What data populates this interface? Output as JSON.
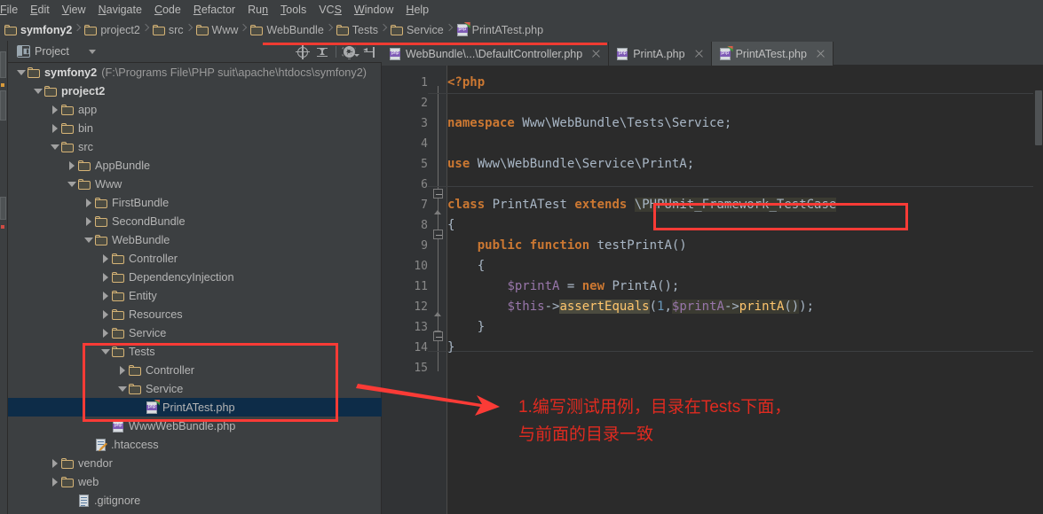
{
  "menubar": {
    "items": [
      {
        "label": "File",
        "mnemonic": "F"
      },
      {
        "label": "Edit",
        "mnemonic": "E"
      },
      {
        "label": "View",
        "mnemonic": "V"
      },
      {
        "label": "Navigate",
        "mnemonic": "N"
      },
      {
        "label": "Code",
        "mnemonic": "C"
      },
      {
        "label": "Refactor",
        "mnemonic": "R"
      },
      {
        "label": "Run",
        "mnemonic": "n"
      },
      {
        "label": "Tools",
        "mnemonic": "T"
      },
      {
        "label": "VCS",
        "mnemonic": "S"
      },
      {
        "label": "Window",
        "mnemonic": "W"
      },
      {
        "label": "Help",
        "mnemonic": "H"
      }
    ]
  },
  "breadcrumb": {
    "items": [
      {
        "label": "symfony2",
        "icon": "folder-icon"
      },
      {
        "label": "project2",
        "icon": "folder-icon"
      },
      {
        "label": "src",
        "icon": "folder-icon"
      },
      {
        "label": "Www",
        "icon": "folder-icon"
      },
      {
        "label": "WebBundle",
        "icon": "folder-icon"
      },
      {
        "label": "Tests",
        "icon": "folder-icon"
      },
      {
        "label": "Service",
        "icon": "folder-icon"
      },
      {
        "label": "PrintATest.php",
        "icon": "php-test-file-icon"
      }
    ]
  },
  "project_panel": {
    "title": "Project",
    "toolbar": [
      {
        "name": "locate-icon",
        "tooltip": "Scroll from Source"
      },
      {
        "name": "collapse-all-icon",
        "tooltip": "Collapse All"
      },
      {
        "name": "gear-icon",
        "tooltip": "Settings"
      },
      {
        "name": "hide-panel-icon",
        "tooltip": "Hide"
      }
    ],
    "tree": [
      {
        "label": "symfony2",
        "path": "(F:\\Programs File\\PHP suit\\apache\\htdocs\\symfony2)",
        "indent": 0,
        "twist": "open",
        "icon": "folder-icon",
        "root": true
      },
      {
        "label": "project2",
        "indent": 1,
        "twist": "open",
        "icon": "folder-icon",
        "bold": true
      },
      {
        "label": "app",
        "indent": 2,
        "twist": "closed",
        "icon": "folder-icon"
      },
      {
        "label": "bin",
        "indent": 2,
        "twist": "closed",
        "icon": "folder-icon"
      },
      {
        "label": "src",
        "indent": 2,
        "twist": "open",
        "icon": "folder-icon"
      },
      {
        "label": "AppBundle",
        "indent": 3,
        "twist": "closed",
        "icon": "folder-icon"
      },
      {
        "label": "Www",
        "indent": 3,
        "twist": "open",
        "icon": "folder-icon"
      },
      {
        "label": "FirstBundle",
        "indent": 4,
        "twist": "closed",
        "icon": "folder-icon"
      },
      {
        "label": "SecondBundle",
        "indent": 4,
        "twist": "closed",
        "icon": "folder-icon"
      },
      {
        "label": "WebBundle",
        "indent": 4,
        "twist": "open",
        "icon": "folder-icon"
      },
      {
        "label": "Controller",
        "indent": 5,
        "twist": "closed",
        "icon": "folder-icon"
      },
      {
        "label": "DependencyInjection",
        "indent": 5,
        "twist": "closed",
        "icon": "folder-icon"
      },
      {
        "label": "Entity",
        "indent": 5,
        "twist": "closed",
        "icon": "folder-icon"
      },
      {
        "label": "Resources",
        "indent": 5,
        "twist": "closed",
        "icon": "folder-icon"
      },
      {
        "label": "Service",
        "indent": 5,
        "twist": "closed",
        "icon": "folder-icon"
      },
      {
        "label": "Tests",
        "indent": 5,
        "twist": "open",
        "icon": "folder-icon"
      },
      {
        "label": "Controller",
        "indent": 6,
        "twist": "closed",
        "icon": "folder-icon"
      },
      {
        "label": "Service",
        "indent": 6,
        "twist": "open",
        "icon": "folder-icon"
      },
      {
        "label": "PrintATest.php",
        "indent": 7,
        "twist": "none",
        "icon": "php-test-file-icon",
        "selected": true
      },
      {
        "label": "WwwWebBundle.php",
        "indent": 5,
        "twist": "none",
        "icon": "php-file-icon"
      },
      {
        "label": ".htaccess",
        "indent": 4,
        "twist": "none",
        "icon": "htaccess-file-icon"
      },
      {
        "label": "vendor",
        "indent": 2,
        "twist": "closed",
        "icon": "folder-icon"
      },
      {
        "label": "web",
        "indent": 2,
        "twist": "closed",
        "icon": "folder-icon"
      },
      {
        "label": ".gitignore",
        "indent": 3,
        "twist": "none",
        "icon": "text-file-icon"
      }
    ]
  },
  "editor_tabs": [
    {
      "label": "WebBundle\\...\\DefaultController.php",
      "icon": "php-file-icon",
      "active": false,
      "closable": true
    },
    {
      "label": "PrintA.php",
      "icon": "php-file-icon",
      "active": false,
      "closable": true
    },
    {
      "label": "PrintATest.php",
      "icon": "php-test-file-icon",
      "active": true,
      "closable": true
    }
  ],
  "editor": {
    "active_file": "PrintATest.php",
    "line_numbers": [
      1,
      2,
      3,
      4,
      5,
      6,
      7,
      8,
      9,
      10,
      11,
      12,
      13,
      14,
      15
    ],
    "lines": [
      {
        "n": 1,
        "text": "<?php"
      },
      {
        "n": 2,
        "text": ""
      },
      {
        "n": 3,
        "text": "namespace Www\\WebBundle\\Tests\\Service;"
      },
      {
        "n": 4,
        "text": ""
      },
      {
        "n": 5,
        "text": "use Www\\WebBundle\\Service\\PrintA;"
      },
      {
        "n": 6,
        "text": ""
      },
      {
        "n": 7,
        "text": "class PrintATest extends \\PHPUnit_Framework_TestCase"
      },
      {
        "n": 8,
        "text": "{"
      },
      {
        "n": 9,
        "text": "    public function testPrintA()"
      },
      {
        "n": 10,
        "text": "    {"
      },
      {
        "n": 11,
        "text": "        $printA = new PrintA();"
      },
      {
        "n": 12,
        "text": "        $this->assertEquals(1,$printA->printA());"
      },
      {
        "n": 13,
        "text": "    }"
      },
      {
        "n": 14,
        "text": "}"
      },
      {
        "n": 15,
        "text": ""
      }
    ],
    "highlighted_spans": [
      "\\PHPUnit_Framework_TestCase",
      "assertEquals",
      "$printA->printA()"
    ],
    "colors": {
      "background": "#2b2b2b",
      "gutter": "#313335",
      "keyword": "#cc7832",
      "variable": "#9876aa",
      "number": "#6897bb",
      "function": "#ffc66d",
      "default_text": "#a9b7c6"
    }
  },
  "annotations": {
    "accent_color": "#fb3b36",
    "text": "1.编写测试用例，目录在Tests下面，\n与前面的目录一致",
    "boxes": [
      "tree-tests-folder-box",
      "code-extends-box"
    ],
    "arrow": "tree-to-note-arrow"
  }
}
